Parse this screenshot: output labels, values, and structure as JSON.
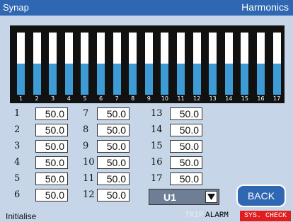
{
  "titlebar": {
    "app": "Synap",
    "page": "Harmonics"
  },
  "colors": {
    "titlebar": "#2f67b2",
    "background": "#c6d6e8",
    "bar_fill": "#3d9bd6",
    "bar_empty": "#ffffff",
    "chart_bg": "#111111",
    "sys_check": "#e21d1d"
  },
  "chart_data": {
    "type": "bar",
    "categories": [
      "1",
      "2",
      "3",
      "4",
      "5",
      "6",
      "7",
      "8",
      "9",
      "10",
      "11",
      "12",
      "13",
      "14",
      "15",
      "16",
      "17"
    ],
    "values": [
      50,
      50,
      50,
      50,
      50,
      50,
      50,
      50,
      50,
      50,
      50,
      50,
      50,
      50,
      50,
      50,
      50
    ],
    "ylim": [
      0,
      100
    ]
  },
  "harmonics": [
    {
      "n": "1",
      "value": "50.0"
    },
    {
      "n": "2",
      "value": "50.0"
    },
    {
      "n": "3",
      "value": "50.0"
    },
    {
      "n": "4",
      "value": "50.0"
    },
    {
      "n": "5",
      "value": "50.0"
    },
    {
      "n": "6",
      "value": "50.0"
    },
    {
      "n": "7",
      "value": "50.0"
    },
    {
      "n": "8",
      "value": "50.0"
    },
    {
      "n": "9",
      "value": "50.0"
    },
    {
      "n": "10",
      "value": "50.0"
    },
    {
      "n": "11",
      "value": "50.0"
    },
    {
      "n": "12",
      "value": "50.0"
    },
    {
      "n": "13",
      "value": "50.0"
    },
    {
      "n": "14",
      "value": "50.0"
    },
    {
      "n": "15",
      "value": "50.0"
    },
    {
      "n": "16",
      "value": "50.0"
    },
    {
      "n": "17",
      "value": "50.0"
    }
  ],
  "selector": {
    "value": "U1",
    "icon": "chevron-down-icon"
  },
  "back_label": "BACK",
  "status": {
    "left": "Initialise",
    "trip": "TRIP",
    "alarm": "ALARM",
    "sys_check": "SYS. CHECK"
  }
}
